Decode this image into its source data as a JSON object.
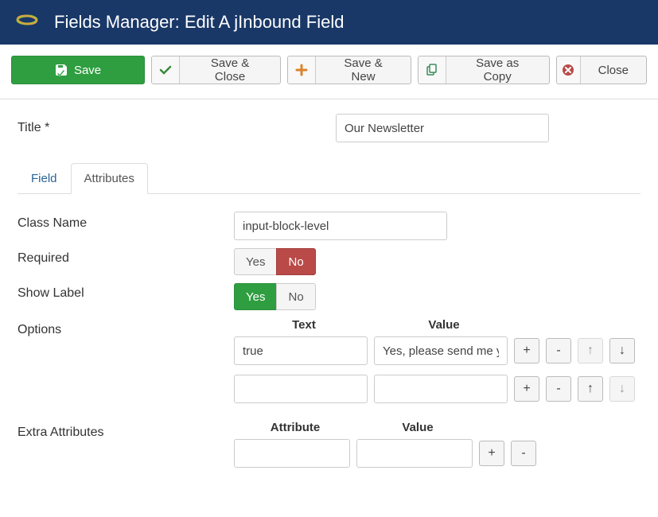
{
  "header": {
    "title": "Fields Manager: Edit A jInbound Field"
  },
  "toolbar": {
    "save": "Save",
    "save_close": "Save & Close",
    "save_new": "Save & New",
    "save_copy": "Save as Copy",
    "close": "Close"
  },
  "form": {
    "title_label": "Title *",
    "title_value": "Our Newsletter"
  },
  "tabs": {
    "field": "Field",
    "attributes": "Attributes"
  },
  "attrs": {
    "class_label": "Class Name",
    "class_value": "input-block-level",
    "required_label": "Required",
    "showlabel_label": "Show Label",
    "yes": "Yes",
    "no": "No",
    "options_label": "Options",
    "options_text_header": "Text",
    "options_value_header": "Value",
    "extra_label": "Extra Attributes",
    "extra_attr_header": "Attribute",
    "extra_value_header": "Value",
    "options": [
      {
        "text": "true",
        "value": "Yes, please send me your newsletter"
      },
      {
        "text": "",
        "value": ""
      }
    ],
    "extra": [
      {
        "attr": "",
        "value": ""
      }
    ],
    "plus": "+",
    "minus": "-",
    "up": "↑",
    "down": "↓"
  }
}
